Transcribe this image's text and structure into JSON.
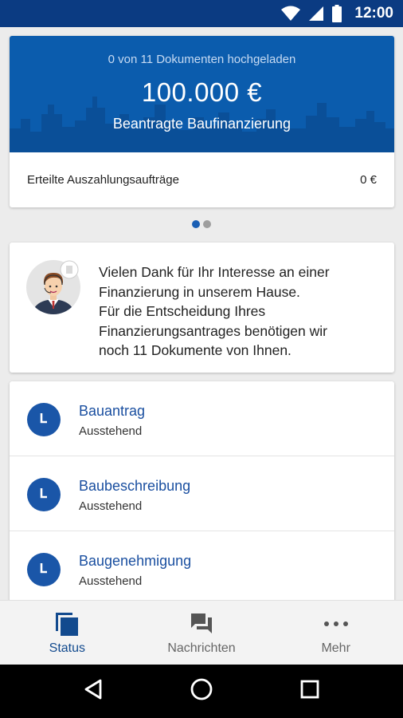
{
  "status_bar": {
    "time": "12:00"
  },
  "summary": {
    "uploaded_text": "0 von 11 Dokumenten hochgeladen",
    "amount": "100.000 €",
    "amount_label": "Beantragte Baufinanzierung",
    "payout_label": "Erteilte Auszahlungsaufträge",
    "payout_value": "0 €",
    "pager_pages": 2,
    "pager_active": 1
  },
  "message": {
    "lines": [
      "Vielen Dank für Ihr Interesse an einer",
      "Finanzierung in unserem Hause.",
      "Für die Entscheidung Ihres",
      "Finanzierungsantrages benötigen wir",
      "noch 11 Dokumente von Ihnen."
    ]
  },
  "documents": [
    {
      "title": "Bauantrag",
      "status": "Ausstehend"
    },
    {
      "title": "Baubeschreibung",
      "status": "Ausstehend"
    },
    {
      "title": "Baugenehmigung",
      "status": "Ausstehend"
    }
  ],
  "bottom_nav": [
    {
      "label": "Status",
      "icon": "status-icon",
      "active": true
    },
    {
      "label": "Nachrichten",
      "icon": "messages-icon",
      "active": false
    },
    {
      "label": "Mehr",
      "icon": "more-icon",
      "active": false
    }
  ],
  "colors": {
    "primary": "#0b5cad",
    "status_bar": "#0b3b82",
    "accent_blue": "#1a56a8",
    "link_blue": "#1a4fa0"
  }
}
